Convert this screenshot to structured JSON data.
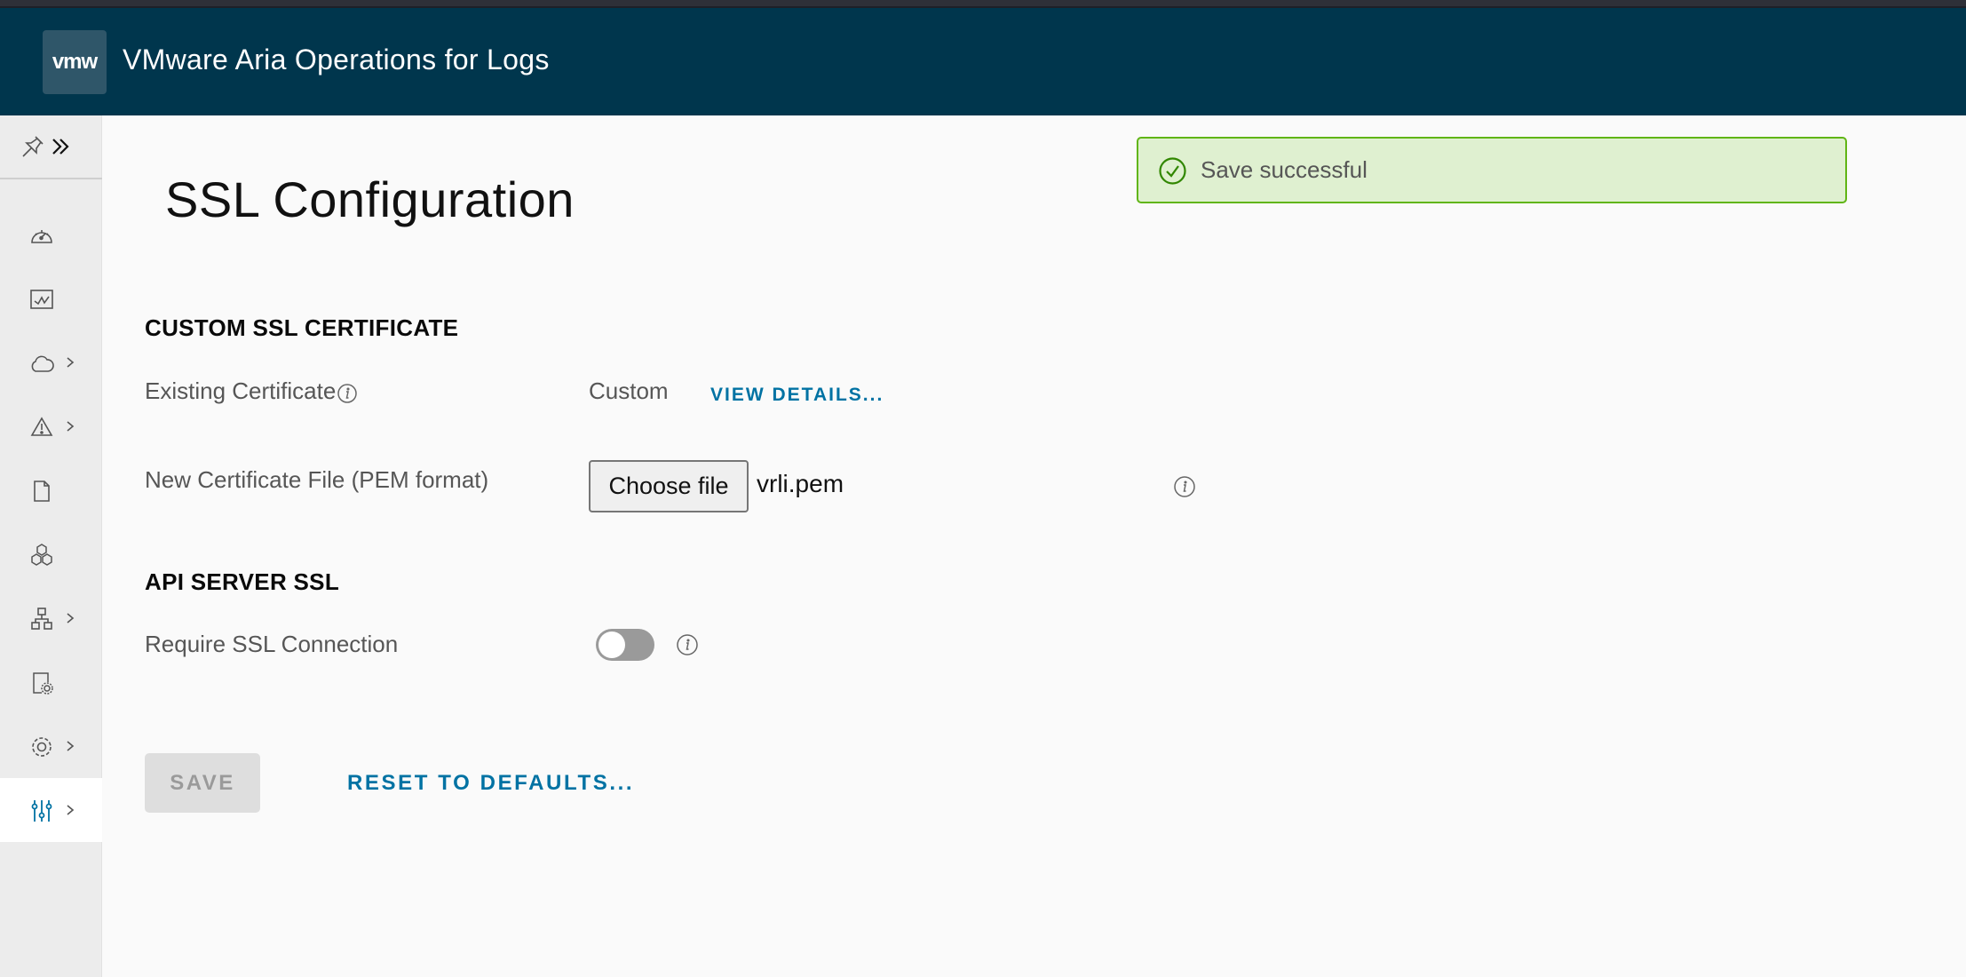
{
  "header": {
    "logo_text": "vmw",
    "app_title": "VMware Aria Operations for Logs"
  },
  "sidebar": {
    "pin_icon": "pin-icon",
    "expand_icon": "double-chevron-right-icon",
    "items": [
      {
        "icon": "dashboard-icon",
        "has_submenu": false,
        "active": false
      },
      {
        "icon": "line-chart-icon",
        "has_submenu": false,
        "active": false
      },
      {
        "icon": "cloud-icon",
        "has_submenu": true,
        "active": false
      },
      {
        "icon": "warning-icon",
        "has_submenu": true,
        "active": false
      },
      {
        "icon": "file-icon",
        "has_submenu": false,
        "active": false
      },
      {
        "icon": "cubes-icon",
        "has_submenu": false,
        "active": false
      },
      {
        "icon": "network-tree-icon",
        "has_submenu": true,
        "active": false
      },
      {
        "icon": "file-settings-icon",
        "has_submenu": false,
        "active": false
      },
      {
        "icon": "gear-icon",
        "has_submenu": true,
        "active": false
      },
      {
        "icon": "sliders-icon",
        "has_submenu": true,
        "active": true
      }
    ]
  },
  "alert": {
    "type": "success",
    "message": "Save successful",
    "icon": "check-circle-icon"
  },
  "page": {
    "title": "SSL Configuration",
    "custom_ssl": {
      "heading": "CUSTOM SSL CERTIFICATE",
      "existing_label": "Existing Certificate",
      "existing_value": "Custom",
      "view_details_link": "VIEW DETAILS...",
      "new_cert_label": "New Certificate File (PEM format)",
      "choose_file_label": "Choose file",
      "selected_file": "vrli.pem"
    },
    "api_ssl": {
      "heading": "API SERVER SSL",
      "require_label": "Require SSL Connection",
      "require_enabled": false
    },
    "actions": {
      "save_label": "SAVE",
      "save_disabled": true,
      "reset_label": "RESET TO DEFAULTS..."
    }
  },
  "colors": {
    "header_bg": "#00364d",
    "link": "#0072a3",
    "success_border": "#60b515",
    "success_bg": "#dff0d0",
    "active_icon": "#0072a3"
  }
}
